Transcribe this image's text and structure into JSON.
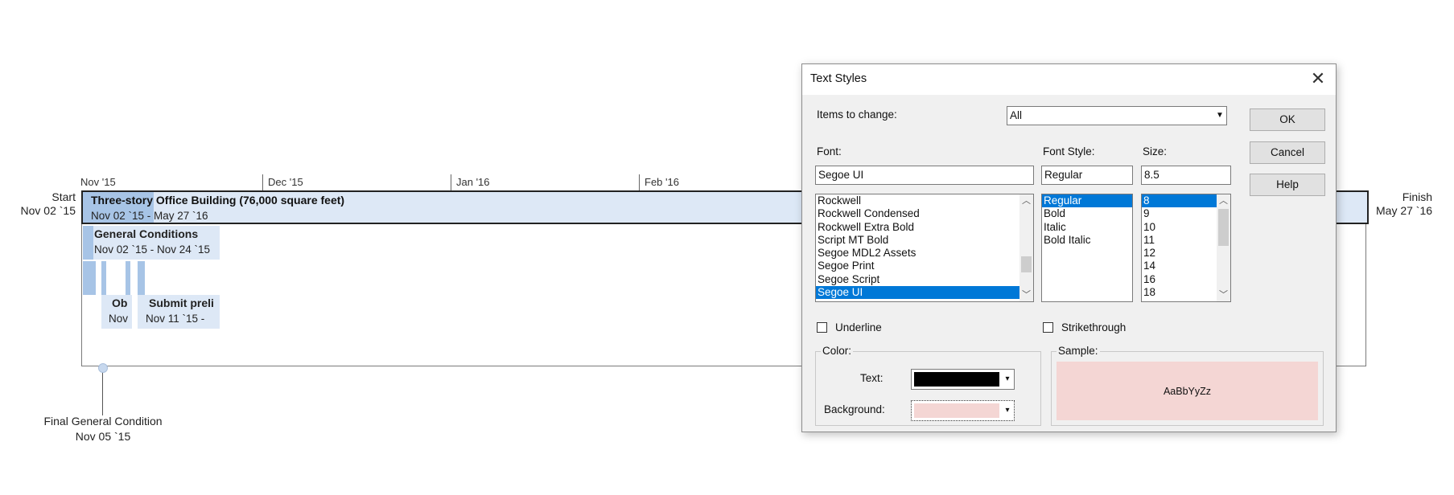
{
  "timeline": {
    "scale_labels": [
      "Nov '15",
      "Dec '15",
      "Jan '16",
      "Feb '16"
    ],
    "start": {
      "label": "Start",
      "date": "Nov 02 `15"
    },
    "finish": {
      "label": "Finish",
      "date": "May 27 `16"
    },
    "main_bar": {
      "title": "Three-story Office Building (76,000 square feet)",
      "dates": "Nov 02 `15 - May 27 `16"
    },
    "tasks": [
      {
        "title": "General Conditions",
        "dates": "Nov 02 `15 - Nov 24 `15"
      },
      {
        "title": "Ob",
        "dates": "Nov"
      },
      {
        "title": "Submit preli",
        "dates": "Nov 11 `15 -"
      }
    ],
    "milestone": {
      "title": "Final General Condition",
      "date": "Nov 05 `15"
    }
  },
  "dialog": {
    "title": "Text Styles",
    "close_glyph": "✕",
    "items_to_change": {
      "label": "Items to change:",
      "value": "All"
    },
    "font": {
      "label": "Font:",
      "value": "Segoe UI",
      "options": [
        "Rockwell",
        "Rockwell Condensed",
        "Rockwell Extra Bold",
        "Script MT Bold",
        "Segoe MDL2 Assets",
        "Segoe Print",
        "Segoe Script",
        "Segoe UI"
      ],
      "selected": "Segoe UI"
    },
    "font_style": {
      "label": "Font Style:",
      "value": "Regular",
      "options": [
        "Regular",
        "Bold",
        "Italic",
        "Bold Italic"
      ],
      "selected": "Regular"
    },
    "size": {
      "label": "Size:",
      "value": "8.5",
      "options": [
        "8",
        "9",
        "10",
        "11",
        "12",
        "14",
        "16",
        "18"
      ],
      "selected": "8"
    },
    "underline": {
      "label": "Underline",
      "checked": false
    },
    "strikethrough": {
      "label": "Strikethrough",
      "checked": false
    },
    "color": {
      "group_label": "Color:",
      "text_label": "Text:",
      "text_color": "#000000",
      "background_label": "Background:",
      "background_color": "#f4d6d4"
    },
    "sample": {
      "label": "Sample:",
      "text": "AaBbYyZz",
      "background": "#f4d6d4"
    },
    "buttons": {
      "ok": "OK",
      "cancel": "Cancel",
      "help": "Help"
    }
  }
}
